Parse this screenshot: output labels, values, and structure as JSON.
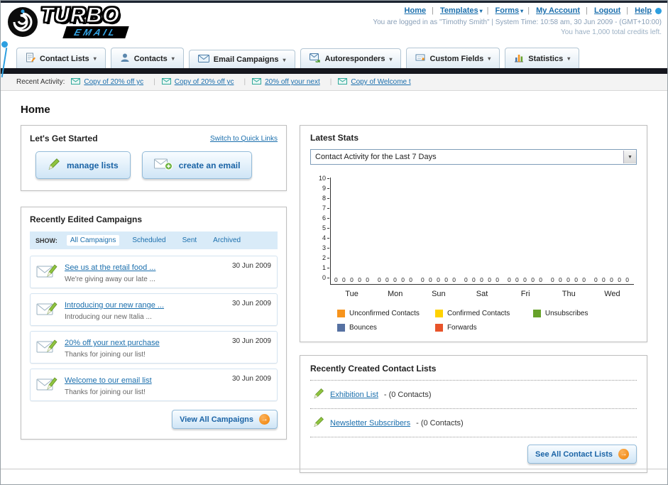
{
  "page_title": "Home",
  "header": {
    "logo": {
      "title": "TURBO",
      "subtitle": "EMAIL"
    },
    "links": [
      {
        "label": "Home"
      },
      {
        "label": "Templates",
        "dropdown": "▾"
      },
      {
        "label": "Forms",
        "dropdown": "▾"
      },
      {
        "label": "My Account"
      },
      {
        "label": "Logout"
      },
      {
        "label": "Help"
      }
    ],
    "login_info": "You are logged in as \"Timothy Smith\" | System Time: 10:58 am, 30 Jun 2009 - (GMT+10:00)",
    "credits": "You have 1,000 total credits left."
  },
  "nav": {
    "tabs": [
      {
        "label": "Contact Lists",
        "dropdown": "▾"
      },
      {
        "label": "Contacts",
        "dropdown": "▾"
      },
      {
        "label": "Email Campaigns",
        "dropdown": "▾"
      },
      {
        "label": "Autoresponders",
        "dropdown": "▾"
      },
      {
        "label": "Custom Fields",
        "dropdown": "▾"
      },
      {
        "label": "Statistics",
        "dropdown": "▾"
      }
    ]
  },
  "recent_activity": {
    "label": "Recent Activity:",
    "items": [
      {
        "label": "Copy of 20% off yc"
      },
      {
        "label": "Copy of 20% off yc"
      },
      {
        "label": "20% off your next"
      },
      {
        "label": "Copy of Welcome t"
      }
    ]
  },
  "get_started": {
    "title": "Let's Get Started",
    "switch_link": "Switch to Quick Links",
    "manage_lists_label": "manage lists",
    "create_email_label": "create an email"
  },
  "campaigns": {
    "title": "Recently Edited Campaigns",
    "show_label": "SHOW:",
    "filters": [
      {
        "label": "All Campaigns",
        "active": true
      },
      {
        "label": "Scheduled"
      },
      {
        "label": "Sent"
      },
      {
        "label": "Archived"
      }
    ],
    "items": [
      {
        "title": "See us at the retail food ...",
        "subtitle": "We're giving away our late ...",
        "date": "30 Jun 2009"
      },
      {
        "title": "Introducing our new range ...",
        "subtitle": "Introducing our new Italia ...",
        "date": "30 Jun 2009"
      },
      {
        "title": "20% off your next purchase",
        "subtitle": "Thanks for joining our list!",
        "date": "30 Jun 2009"
      },
      {
        "title": "Welcome to our email list",
        "subtitle": "Thanks for joining our list!",
        "date": "30 Jun 2009"
      }
    ],
    "view_all_label": "View All Campaigns"
  },
  "stats": {
    "title": "Latest Stats",
    "period_select": "Contact Activity for the Last 7 Days",
    "chart_data": {
      "type": "bar",
      "title": "Contact Activity for the Last 7 Days",
      "categories": [
        "Tue",
        "Mon",
        "Sun",
        "Sat",
        "Fri",
        "Thu",
        "Wed"
      ],
      "series": [
        {
          "name": "Unconfirmed Contacts",
          "color": "#f7941d",
          "values": [
            0,
            0,
            0,
            0,
            0,
            0,
            0
          ]
        },
        {
          "name": "Confirmed Contacts",
          "color": "#ffd200",
          "values": [
            0,
            0,
            0,
            0,
            0,
            0,
            0
          ]
        },
        {
          "name": "Unsubscribes",
          "color": "#67a22a",
          "values": [
            0,
            0,
            0,
            0,
            0,
            0,
            0
          ]
        },
        {
          "name": "Bounces",
          "color": "#5671a2",
          "values": [
            0,
            0,
            0,
            0,
            0,
            0,
            0
          ]
        },
        {
          "name": "Forwards",
          "color": "#e8542a",
          "values": [
            0,
            0,
            0,
            0,
            0,
            0,
            0
          ]
        }
      ],
      "ylim": [
        0,
        10
      ],
      "ytick_labels": [
        "10",
        "9",
        "8",
        "7",
        "6",
        "5",
        "4",
        "3",
        "2",
        "1",
        "0"
      ],
      "value_labels": [
        "0 0 0 0 0",
        "0 0 0 0 0",
        "0 0 0 0 0",
        "0 0 0 0 0",
        "0 0 0 0 0",
        "0 0 0 0 0",
        "0 0 0 0 0"
      ],
      "grid": false,
      "legend_position": "bottom"
    }
  },
  "contact_lists": {
    "title": "Recently Created Contact Lists",
    "items": [
      {
        "name": "Exhibition List",
        "detail": "- (0 Contacts)"
      },
      {
        "name": "Newsletter Subscribers",
        "detail": "- (0 Contacts)"
      }
    ],
    "see_all_label": "See All Contact Lists"
  }
}
